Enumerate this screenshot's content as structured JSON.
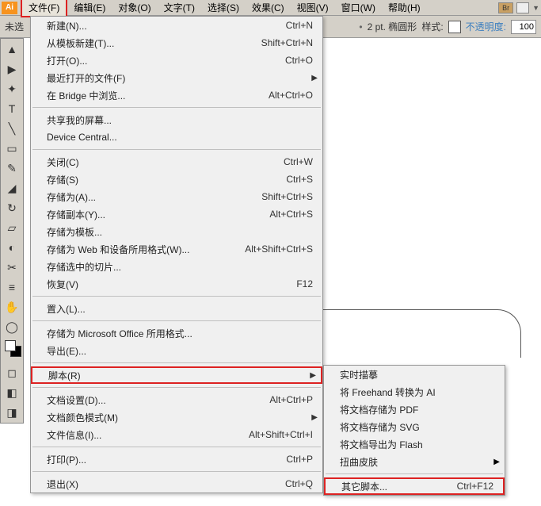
{
  "app": {
    "icon_text": "Ai"
  },
  "menubar": {
    "items": [
      "文件(F)",
      "编辑(E)",
      "对象(O)",
      "文字(T)",
      "选择(S)",
      "效果(C)",
      "视图(V)",
      "窗口(W)",
      "帮助(H)"
    ],
    "badge": "Br"
  },
  "toolbar": {
    "left_label": "未选",
    "stroke_label": "2 pt. 椭圆形",
    "style_label": "样式:",
    "opacity_label": "不透明度:",
    "opacity_value": "100",
    "opacity_color": "#3a7ebf"
  },
  "file_menu": [
    {
      "label": "新建(N)...",
      "shortcut": "Ctrl+N"
    },
    {
      "label": "从模板新建(T)...",
      "shortcut": "Shift+Ctrl+N"
    },
    {
      "label": "打开(O)...",
      "shortcut": "Ctrl+O"
    },
    {
      "label": "最近打开的文件(F)",
      "submenu": true
    },
    {
      "label": "在 Bridge 中浏览...",
      "shortcut": "Alt+Ctrl+O"
    },
    {
      "sep": true
    },
    {
      "label": "共享我的屏幕..."
    },
    {
      "label": "Device Central..."
    },
    {
      "sep": true
    },
    {
      "label": "关闭(C)",
      "shortcut": "Ctrl+W"
    },
    {
      "label": "存储(S)",
      "shortcut": "Ctrl+S"
    },
    {
      "label": "存储为(A)...",
      "shortcut": "Shift+Ctrl+S"
    },
    {
      "label": "存储副本(Y)...",
      "shortcut": "Alt+Ctrl+S"
    },
    {
      "label": "存储为模板..."
    },
    {
      "label": "存储为 Web 和设备所用格式(W)...",
      "shortcut": "Alt+Shift+Ctrl+S"
    },
    {
      "label": "存储选中的切片..."
    },
    {
      "label": "恢复(V)",
      "shortcut": "F12"
    },
    {
      "sep": true
    },
    {
      "label": "置入(L)..."
    },
    {
      "sep": true
    },
    {
      "label": "存储为 Microsoft Office 所用格式..."
    },
    {
      "label": "导出(E)..."
    },
    {
      "sep": true
    },
    {
      "label": "脚本(R)",
      "submenu": true,
      "hl": true
    },
    {
      "sep": true
    },
    {
      "label": "文档设置(D)...",
      "shortcut": "Alt+Ctrl+P"
    },
    {
      "label": "文档颜色模式(M)",
      "submenu": true
    },
    {
      "label": "文件信息(I)...",
      "shortcut": "Alt+Shift+Ctrl+I"
    },
    {
      "sep": true
    },
    {
      "label": "打印(P)...",
      "shortcut": "Ctrl+P"
    },
    {
      "sep": true
    },
    {
      "label": "退出(X)",
      "shortcut": "Ctrl+Q"
    }
  ],
  "scripts_submenu": [
    {
      "label": "实时描摹"
    },
    {
      "label": "将 Freehand 转换为 AI"
    },
    {
      "label": "将文档存储为 PDF"
    },
    {
      "label": "将文档存储为 SVG"
    },
    {
      "label": "将文档导出为 Flash"
    },
    {
      "label": "扭曲皮肤",
      "submenu": true
    },
    {
      "sep": true
    },
    {
      "label": "其它脚本...",
      "shortcut": "Ctrl+F12",
      "hl": true
    }
  ],
  "tools": [
    "▲",
    "▶",
    "✦",
    "T",
    "╲",
    "▭",
    "✎",
    "◢",
    "↻",
    "▱",
    "◐",
    "✂",
    "≡",
    "✋",
    "◯"
  ]
}
